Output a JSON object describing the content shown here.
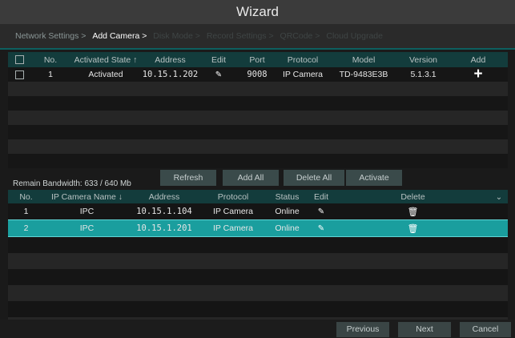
{
  "window": {
    "title": "Wizard"
  },
  "breadcrumb": [
    {
      "label": "Network Settings >",
      "state": "done"
    },
    {
      "label": "Add Camera >",
      "state": "active"
    },
    {
      "label": "Disk Mode >",
      "state": "future"
    },
    {
      "label": "Record Settings >",
      "state": "future"
    },
    {
      "label": "QRCode >",
      "state": "future"
    },
    {
      "label": "Cloud Upgrade",
      "state": "future"
    }
  ],
  "search_table": {
    "headers": {
      "no": "No.",
      "activated_state": "Activated State",
      "sort_icon": "↑",
      "address": "Address",
      "edit": "Edit",
      "port": "Port",
      "protocol": "Protocol",
      "model": "Model",
      "version": "Version",
      "add": "Add"
    },
    "rows": [
      {
        "no": "1",
        "activated_state": "Activated",
        "address": "10.15.1.202",
        "port": "9008",
        "protocol": "IP Camera",
        "model": "TD-9483E3B",
        "version": "5.1.3.1"
      }
    ]
  },
  "bandwidth": {
    "label": "Remain Bandwidth: 633 / 640 Mb"
  },
  "actions": {
    "refresh": "Refresh",
    "add_all": "Add All",
    "delete_all": "Delete All",
    "activate": "Activate"
  },
  "added_table": {
    "headers": {
      "no": "No.",
      "name": "IP Camera Name",
      "sort_icon": "↓",
      "address": "Address",
      "protocol": "Protocol",
      "status": "Status",
      "edit": "Edit",
      "delete": "Delete",
      "expand_icon": "⌄"
    },
    "rows": [
      {
        "no": "1",
        "name": "IPC",
        "address": "10.15.1.104",
        "protocol": "IP Camera",
        "status": "Online"
      },
      {
        "no": "2",
        "name": "IPC",
        "address": "10.15.1.201",
        "protocol": "IP Camera",
        "status": "Online"
      }
    ]
  },
  "footer": {
    "previous": "Previous",
    "next": "Next",
    "cancel": "Cancel"
  },
  "icons": {
    "add": "+",
    "edit": "✎",
    "delete": "🗑"
  },
  "colors": {
    "accent": "#1a9e9e",
    "header_bg": "#133c3c",
    "online": "#22ee22"
  }
}
